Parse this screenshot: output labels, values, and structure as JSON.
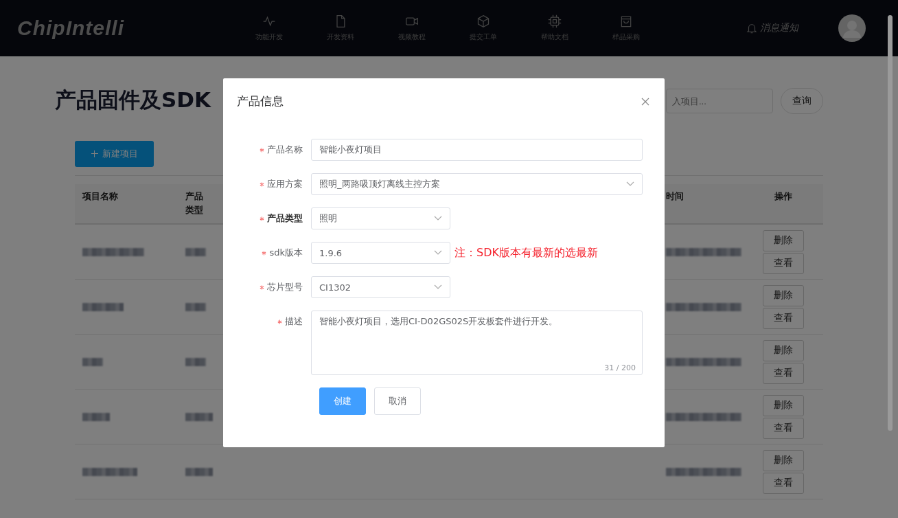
{
  "header": {
    "logo": "ChipIntelli",
    "nav": [
      {
        "label": "功能开发"
      },
      {
        "label": "开发资料"
      },
      {
        "label": "视频教程"
      },
      {
        "label": "提交工单"
      },
      {
        "label": "帮助文档"
      },
      {
        "label": "样品采购"
      }
    ],
    "notifications": "消息通知"
  },
  "page": {
    "title": "产品固件及SDK",
    "search": {
      "placeholder": "入项目..."
    },
    "search_button": "查询",
    "new_button": "新建项目"
  },
  "table": {
    "columns": [
      {
        "label": "项目名称"
      },
      {
        "label": "产品类型"
      },
      {
        "label": "时间"
      },
      {
        "label": "操作"
      }
    ],
    "rows": [
      {
        "actions": [
          "删除",
          "查看"
        ]
      },
      {
        "actions": [
          "删除",
          "查看"
        ]
      },
      {
        "actions": [
          "删除",
          "查看"
        ]
      },
      {
        "actions": [
          "删除",
          "查看"
        ]
      },
      {
        "actions": [
          "删除",
          "查看"
        ]
      }
    ]
  },
  "dialog": {
    "title": "产品信息",
    "fields": [
      {
        "kind": "input",
        "label": "产品名称",
        "required": true,
        "bold": false,
        "value": "智能小夜灯项目"
      },
      {
        "kind": "select",
        "label": "应用方案",
        "required": true,
        "bold": false,
        "value": "照明_两路吸顶灯离线主控方案",
        "wide": true
      },
      {
        "kind": "select",
        "label": "产品类型",
        "required": true,
        "bold": true,
        "value": "照明",
        "wide": false
      },
      {
        "kind": "select",
        "label": "sdk版本",
        "required": true,
        "bold": false,
        "value": "1.9.6",
        "wide": false,
        "note": "注：SDK版本有最新的选最新"
      },
      {
        "kind": "select",
        "label": "芯片型号",
        "required": true,
        "bold": false,
        "value": "CI1302",
        "wide": false
      },
      {
        "kind": "textarea",
        "label": "描述",
        "required": true,
        "bold": false,
        "value": "智能小夜灯项目，选用CI-D02GS02S开发板套件进行开发。",
        "counter": "31 / 200"
      }
    ],
    "buttons": [
      {
        "label": "创建",
        "kind": "primary"
      },
      {
        "label": "取消",
        "kind": "default"
      }
    ]
  }
}
